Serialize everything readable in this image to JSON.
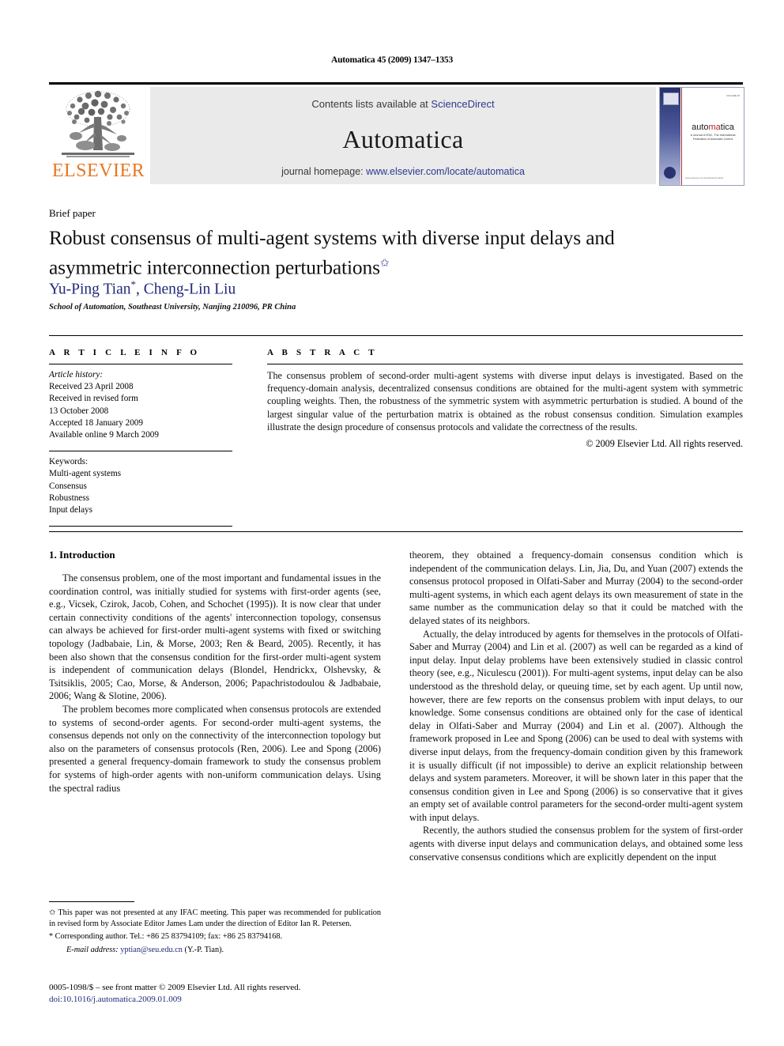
{
  "running_head": "Automatica 45 (2009) 1347–1353",
  "masthead": {
    "contents_prefix": "Contents lists available at ",
    "sciencedirect": "ScienceDirect",
    "journal_name": "Automatica",
    "homepage_prefix": "journal homepage: ",
    "homepage_url": "www.elsevier.com/locate/automatica",
    "publisher": "ELSEVIER",
    "cover": {
      "title_a": "auto",
      "title_red": "ma",
      "title_b": "tica",
      "subtitle": "A Journal of IFAC, The International Federation of Automatic Control",
      "top_right": "VOLUME 45",
      "bottom_right": "www.elsevier.com/locate/automatica"
    }
  },
  "article": {
    "type_label": "Brief paper",
    "title": "Robust consensus of multi-agent systems with diverse input delays and asymmetric interconnection perturbations",
    "title_marker": "✩",
    "authors": "Yu-Ping Tian",
    "author_marker": "*",
    "authors_rest": ", Cheng-Lin Liu",
    "affiliation": "School of Automation, Southeast University, Nanjing 210096, PR China"
  },
  "info": {
    "heading": "A R T I C L E   I N F O",
    "history_label": "Article history:",
    "history": [
      "Received 23 April 2008",
      "Received in revised form",
      "13 October 2008",
      "Accepted 18 January 2009",
      "Available online 9 March 2009"
    ],
    "keywords_label": "Keywords:",
    "keywords": [
      "Multi-agent systems",
      "Consensus",
      "Robustness",
      "Input delays"
    ]
  },
  "abstract": {
    "heading": "A B S T R A C T",
    "text": "The consensus problem of second-order multi-agent systems with diverse input delays is investigated. Based on the frequency-domain analysis, decentralized consensus conditions are obtained for the multi-agent system with symmetric coupling weights. Then, the robustness of the symmetric system with asymmetric perturbation is studied. A bound of the largest singular value of the perturbation matrix is obtained as the robust consensus condition. Simulation examples illustrate the design procedure of consensus protocols and validate the correctness of the results.",
    "copyright": "© 2009 Elsevier Ltd. All rights reserved."
  },
  "body": {
    "section_title": "1. Introduction",
    "left_paragraphs": [
      "The consensus problem, one of the most important and fundamental issues in the coordination control, was initially studied for systems with first-order agents (see, e.g., Vicsek, Czirok, Jacob, Cohen, and Schochet (1995)). It is now clear that under certain connectivity conditions of the agents' interconnection topology, consensus can always be achieved for first-order multi-agent systems with fixed or switching topology (Jadbabaie, Lin, & Morse, 2003; Ren & Beard, 2005). Recently, it has been also shown that the consensus condition for the first-order multi-agent system is independent of communication delays (Blondel, Hendrickx, Olshevsky, & Tsitsiklis, 2005; Cao, Morse, & Anderson, 2006; Papachristodoulou & Jadbabaie, 2006; Wang & Slotine, 2006).",
      "The problem becomes more complicated when consensus protocols are extended to systems of second-order agents. For second-order multi-agent systems, the consensus depends not only on the connectivity of the interconnection topology but also on the parameters of consensus protocols (Ren, 2006). Lee and Spong (2006) presented a general frequency-domain framework to study the consensus problem for systems of high-order agents with non-uniform communication delays. Using the spectral radius"
    ],
    "right_paragraphs": [
      "theorem, they obtained a frequency-domain consensus condition which is independent of the communication delays. Lin, Jia, Du, and Yuan (2007) extends the consensus protocol proposed in Olfati-Saber and Murray (2004) to the second-order multi-agent systems, in which each agent delays its own measurement of state in the same number as the communication delay so that it could be matched with the delayed states of its neighbors.",
      "Actually, the delay introduced by agents for themselves in the protocols of Olfati-Saber and Murray (2004) and Lin et al. (2007) as well can be regarded as a kind of input delay. Input delay problems have been extensively studied in classic control theory (see, e.g., Niculescu (2001)). For multi-agent systems, input delay can be also understood as the threshold delay, or queuing time, set by each agent. Up until now, however, there are few reports on the consensus problem with input delays, to our knowledge. Some consensus conditions are obtained only for the case of identical delay in Olfati-Saber and Murray (2004) and Lin et al. (2007). Although the framework proposed in Lee and Spong (2006) can be used to deal with systems with diverse input delays, from the frequency-domain condition given by this framework it is usually difficult (if not impossible) to derive an explicit relationship between delays and system parameters. Moreover, it will be shown later in this paper that the consensus condition given in Lee and Spong (2006) is so conservative that it gives an empty set of available control parameters for the second-order multi-agent system with input delays.",
      "Recently, the authors studied the consensus problem for the system of first-order agents with diverse input delays and communication delays, and obtained some less conservative consensus conditions which are explicitly dependent on the input"
    ]
  },
  "footnotes": {
    "star_marker": "✩",
    "star_text": "This paper was not presented at any IFAC meeting. This paper was recommended for publication in revised form by Associate Editor James Lam under the direction of Editor Ian R. Petersen.",
    "corr_marker": "*",
    "corr_text": "Corresponding author. Tel.: +86 25 83794109; fax: +86 25 83794168.",
    "email_label": "E-mail address:",
    "email": "yptian@seu.edu.cn",
    "email_suffix": "(Y.-P. Tian)."
  },
  "imprint": {
    "line1": "0005-1098/$ – see front matter © 2009 Elsevier Ltd. All rights reserved.",
    "doi": "doi:10.1016/j.automatica.2009.01.009"
  },
  "colors": {
    "link": "#20287a",
    "elsevier_orange": "#E87722",
    "masthead_bg": "#eaeaea"
  }
}
